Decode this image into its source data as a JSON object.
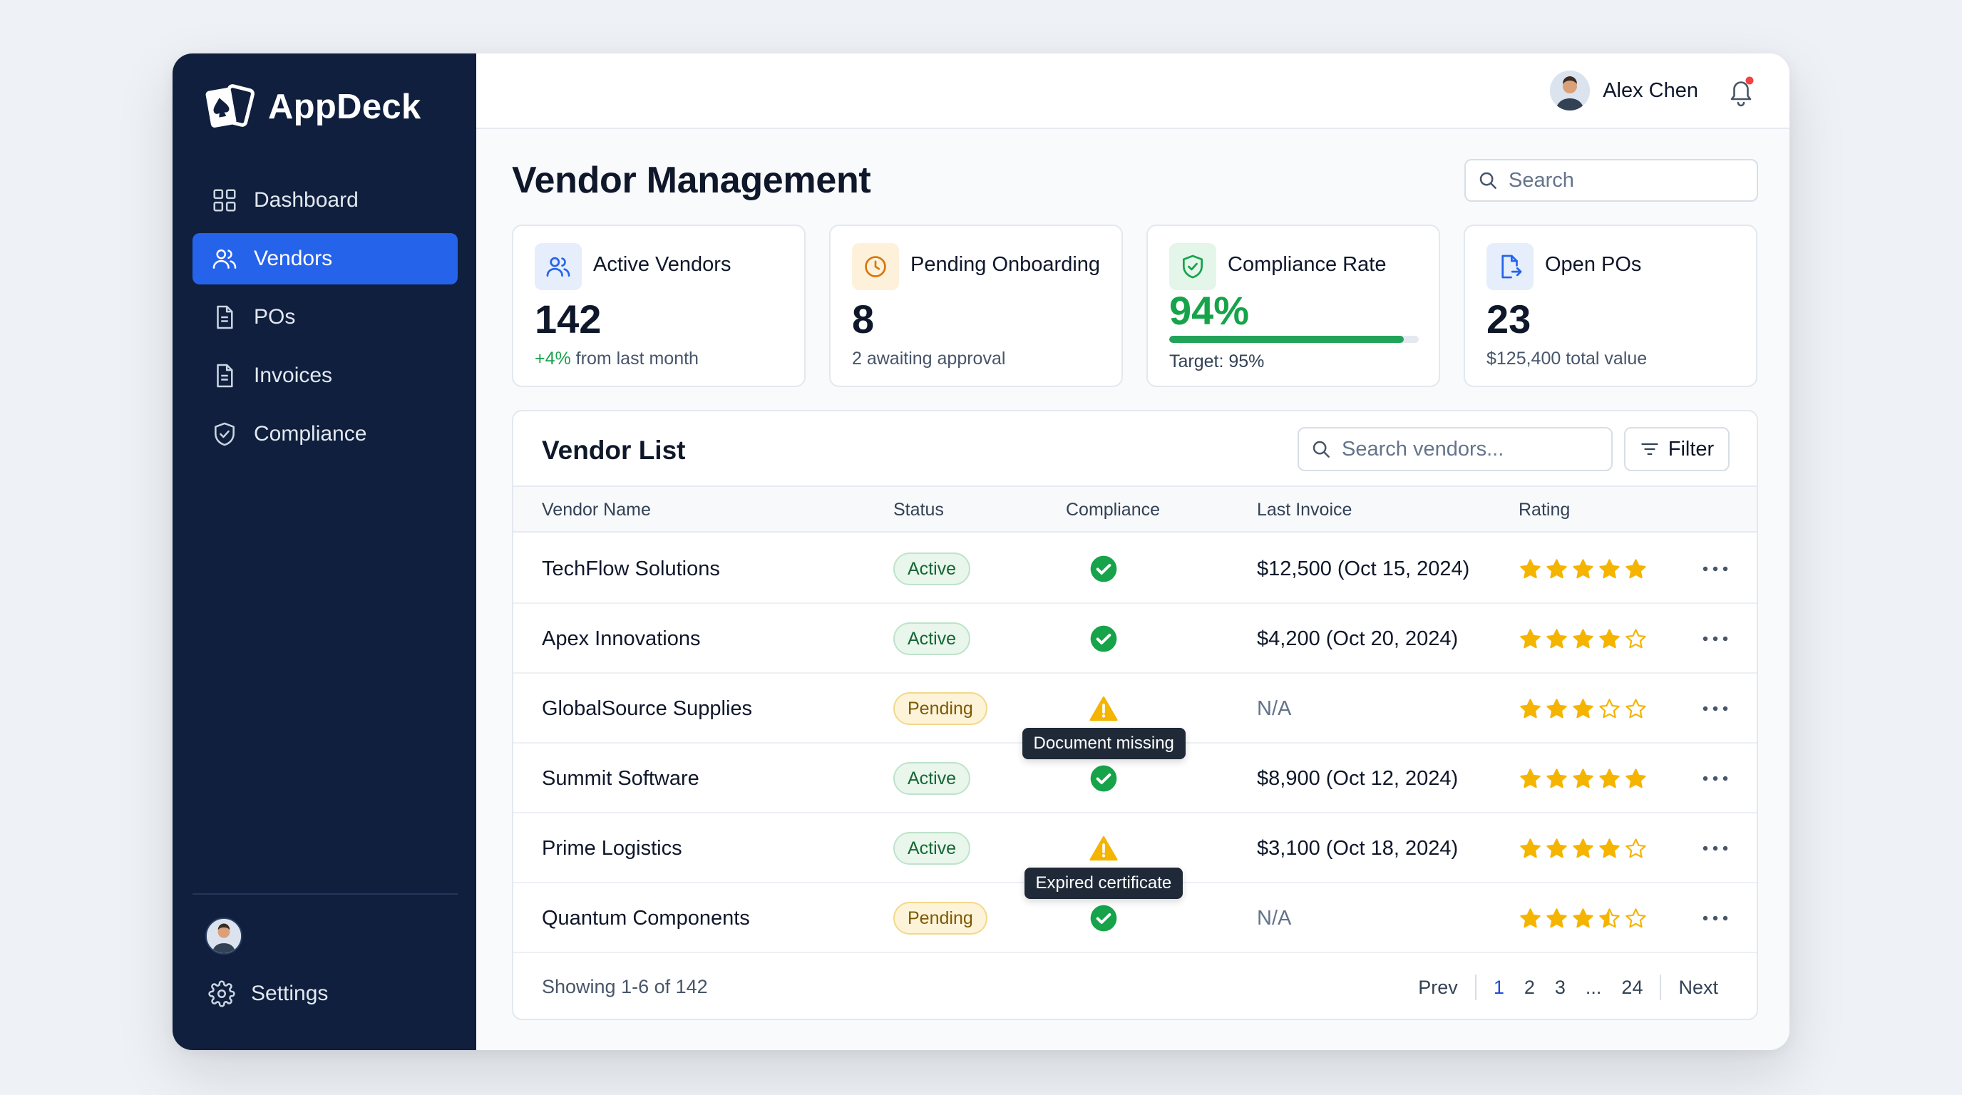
{
  "app": {
    "name": "AppDeck"
  },
  "sidebar": {
    "items": [
      {
        "label": "Dashboard",
        "icon": "grid-icon"
      },
      {
        "label": "Vendors",
        "icon": "users-icon",
        "active": true
      },
      {
        "label": "POs",
        "icon": "document-icon"
      },
      {
        "label": "Invoices",
        "icon": "document-icon"
      },
      {
        "label": "Compliance",
        "icon": "shield-check-icon"
      }
    ],
    "settings_label": "Settings"
  },
  "topbar": {
    "user_name": "Alex Chen",
    "notification_dot": true
  },
  "page": {
    "title": "Vendor Management",
    "search_placeholder": "Search"
  },
  "stats": [
    {
      "label": "Active Vendors",
      "value": "142",
      "delta": "+4%",
      "sub": " from last month",
      "icon": "users-icon",
      "color": "#2563eb"
    },
    {
      "label": "Pending Onboarding",
      "value": "8",
      "sub": "2 awaiting approval",
      "icon": "clock-icon",
      "color": "#d97706"
    },
    {
      "label": "Compliance Rate",
      "value": "94%",
      "progress": 0.94,
      "sub": "Target: 95%",
      "icon": "shield-check-icon",
      "color": "#16a34a"
    },
    {
      "label": "Open POs",
      "value": "23",
      "sub": "$125,400 total value",
      "icon": "file-export-icon",
      "color": "#2563eb"
    }
  ],
  "vendor_list": {
    "title": "Vendor List",
    "search_placeholder": "Search vendors...",
    "filter_label": "Filter",
    "columns": [
      "Vendor Name",
      "Status",
      "Compliance",
      "Last Invoice",
      "Rating"
    ],
    "rows": [
      {
        "name": "TechFlow Solutions",
        "status": "Active",
        "compliance": "ok",
        "last_invoice": "$12,500 (Oct 15, 2024)",
        "rating": 5
      },
      {
        "name": "Apex Innovations",
        "status": "Active",
        "compliance": "ok",
        "last_invoice": "$4,200 (Oct 20, 2024)",
        "rating": 4
      },
      {
        "name": "GlobalSource Supplies",
        "status": "Pending",
        "compliance": "warning",
        "tooltip": "Document missing",
        "last_invoice": "N/A",
        "rating": 3
      },
      {
        "name": "Summit Software",
        "status": "Active",
        "compliance": "ok",
        "last_invoice": "$8,900 (Oct 12, 2024)",
        "rating": 5
      },
      {
        "name": "Prime Logistics",
        "status": "Active",
        "compliance": "warning",
        "tooltip": "Expired certificate",
        "last_invoice": "$3,100 (Oct 18, 2024)",
        "rating": 4
      },
      {
        "name": "Quantum Components",
        "status": "Pending",
        "compliance": "ok",
        "last_invoice": "N/A",
        "rating": 3.5
      }
    ],
    "showing": "Showing 1-6 of 142",
    "pagination": {
      "prev": "Prev",
      "pages": [
        "1",
        "2",
        "3",
        "...",
        "24"
      ],
      "current": "1",
      "next": "Next"
    }
  },
  "colors": {
    "sidebar": "#0f1f3d",
    "accent": "#2563eb",
    "success": "#16a34a",
    "warning": "#f5b400",
    "star": "#f5b400"
  }
}
